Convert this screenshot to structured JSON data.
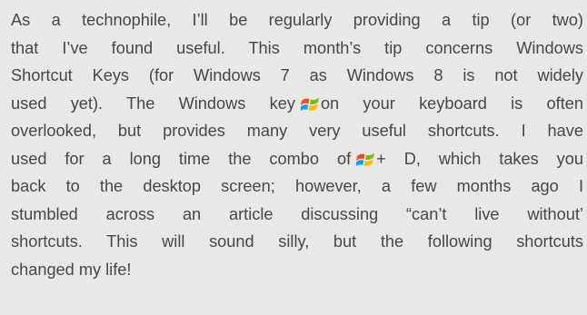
{
  "article": {
    "lines": {
      "l1": "As a technophile, I’ll be regularly providing a tip (or two)",
      "l2": "that I’ve found useful.  This month’s tip concerns Windows",
      "l3": "Shortcut Keys (for Windows 7 as Windows 8 is not widely",
      "l4a": "used yet).  The Windows key",
      "l4b": "on your keyboard is often",
      "l5": "overlooked, but provides many very useful shortcuts.  I have",
      "l6a": "used for a long time the combo of",
      "l6b": "+ D, which takes you",
      "l7": "back to the desktop screen; however, a few months ago I",
      "l8": "stumbled across an article discussing “can’t live without’",
      "l9": "shortcuts.  This will sound silly, but the following shortcuts",
      "l10": "changed my life!"
    },
    "icons": {
      "windows_key": "windows-logo-icon"
    },
    "colors": {
      "background": "#eae8e7",
      "text": "#474747"
    }
  }
}
